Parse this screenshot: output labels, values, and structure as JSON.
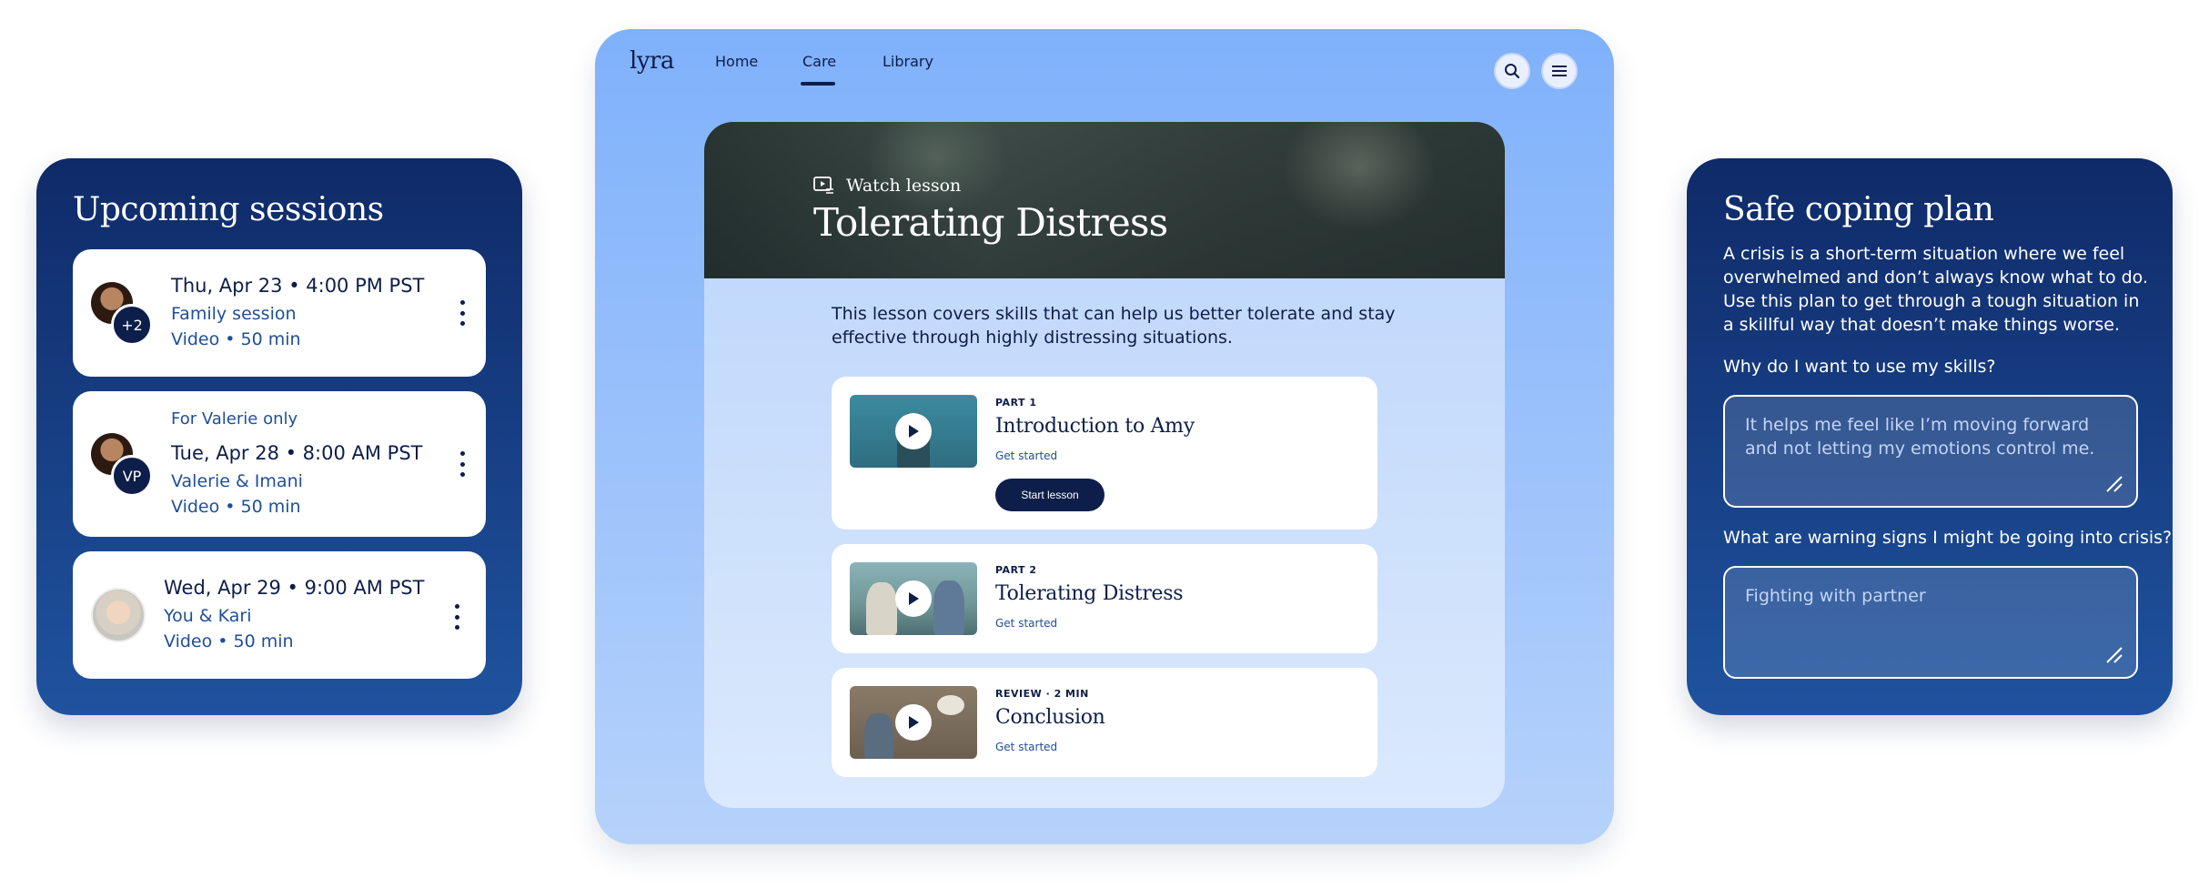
{
  "sessions": {
    "title": "Upcoming sessions",
    "items": [
      {
        "eyebrow": "",
        "date": "Thu, Apr 23 • 4:00 PM PST",
        "who": "Family session",
        "detail": "Video • 50 min",
        "badge": "+2"
      },
      {
        "eyebrow": "For Valerie only",
        "date": "Tue, Apr 28 • 8:00 AM PST",
        "who": "Valerie & Imani",
        "detail": "Video • 50 min",
        "badge": "VP"
      },
      {
        "eyebrow": "",
        "date": "Wed, Apr 29 • 9:00 AM PST",
        "who": "You & Kari",
        "detail": "Video • 50 min",
        "badge": ""
      }
    ]
  },
  "app": {
    "logo": "lyra",
    "nav": [
      "Home",
      "Care",
      "Library"
    ],
    "active_nav": "Care",
    "hero": {
      "label": "Watch lesson",
      "title": "Tolerating Distress"
    },
    "description": "This lesson covers skills that can help us better tolerate and stay effective through highly distressing situations.",
    "lessons": [
      {
        "eyebrow": "PART 1",
        "title": "Introduction to Amy",
        "link": "Get started",
        "button": "Start lesson"
      },
      {
        "eyebrow": "PART 2",
        "title": "Tolerating Distress",
        "link": "Get started"
      },
      {
        "eyebrow": "REVIEW · 2 MIN",
        "title": "Conclusion",
        "link": "Get started"
      }
    ]
  },
  "coping": {
    "title": "Safe coping plan",
    "description": "A crisis is a short-term situation where we feel overwhelmed and don’t always know what to do. Use this plan to get through a tough situation in a skillful way that doesn’t make things worse.",
    "q1": "Why do I want to use my skills?",
    "a1": "It helps me feel like I’m moving forward and not letting my emotions control me.",
    "q2": "What are warning signs I might be going into crisis?",
    "a2": "Fighting with partner"
  },
  "colors": {
    "navy": "#0d1e4a",
    "accent_blue": "#1f4f9a",
    "app_blue": "#7fb1fb"
  },
  "icons": [
    "kebab-icon",
    "search-icon",
    "menu-icon",
    "watch-lesson-icon",
    "play-icon",
    "resize-icon"
  ]
}
